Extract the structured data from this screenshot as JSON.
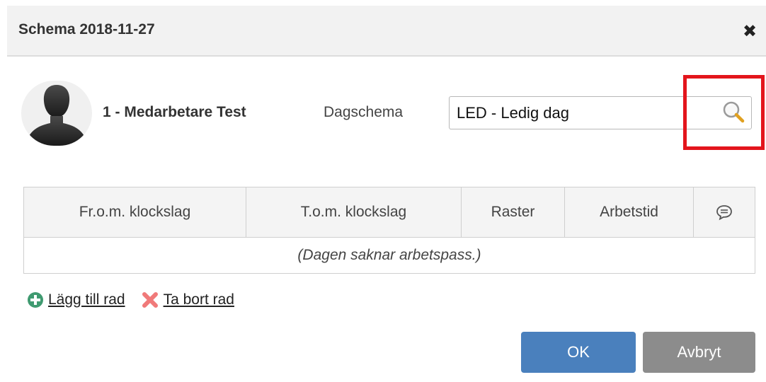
{
  "dialog": {
    "title": "Schema 2018-11-27",
    "close_icon": "close-icon"
  },
  "employee": {
    "name": "1 - Medarbetare Test",
    "avatar_icon": "user-silhouette-avatar"
  },
  "day_schedule": {
    "label": "Dagschema",
    "value": "LED - Ledig dag",
    "search_icon": "magnifier-search-icon"
  },
  "table": {
    "headers": [
      "Fr.o.m. klockslag",
      "T.o.m. klockslag",
      "Raster",
      "Arbetstid"
    ],
    "comment_icon": "speech-bubble-icon",
    "empty_message": "(Dagen saknar arbetspass.)"
  },
  "actions": {
    "add_row": "Lägg till rad",
    "add_icon": "plus-circle-icon",
    "remove_row": "Ta bort rad",
    "remove_icon": "red-x-icon"
  },
  "buttons": {
    "ok": "OK",
    "cancel": "Avbryt"
  },
  "colors": {
    "primary_button": "#4a80bd",
    "secondary_button": "#8c8c8c",
    "highlight": "#e3151c",
    "add_icon": "#3f9a70",
    "remove_icon": "#f07a7a"
  }
}
